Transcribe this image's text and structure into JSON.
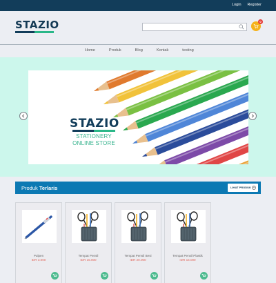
{
  "topbar": {
    "login": "Login",
    "register": "Register"
  },
  "header": {
    "logo": "STAZIO",
    "search": {
      "value": "",
      "placeholder": ""
    },
    "cart_count": "0"
  },
  "nav": {
    "items": [
      "Home",
      "Produk",
      "Blog",
      "Kontak",
      "testing"
    ]
  },
  "hero": {
    "brand": "STAZIO",
    "tagline_1": "STATIONERY",
    "tagline_2": "ONLINE STORE",
    "pencil_colors": [
      "#e07a2e",
      "#f1c23a",
      "#7ac043",
      "#2aa84f",
      "#4f86d8",
      "#2b4c9b",
      "#7d4aa8",
      "#e04646",
      "#e9a43a",
      "#38b6a6"
    ]
  },
  "section": {
    "title_light": "Produk ",
    "title_bold": "Terlaris",
    "more_label": "LIHAT PRODUK"
  },
  "products": [
    {
      "name": "Pulpen",
      "price": "IDR 3.000",
      "icon": "pen-icon"
    },
    {
      "name": "Tempat Pensil",
      "price": "IDR 15.000",
      "icon": "pencil-holder-icon"
    },
    {
      "name": "Tempat Pensil Besi",
      "price": "IDR 20.000",
      "icon": "pencil-holder-icon"
    },
    {
      "name": "Tempat Pensil Plastik",
      "price": "IDR 15.000",
      "icon": "pencil-holder-icon"
    }
  ],
  "colors": {
    "topbar": "#123d5a",
    "accent_blue": "#0c79b3",
    "accent_green": "#2ab788",
    "hero_bg": "#ccf7ec",
    "price": "#e26a5f",
    "cart": "#f5b21a"
  }
}
